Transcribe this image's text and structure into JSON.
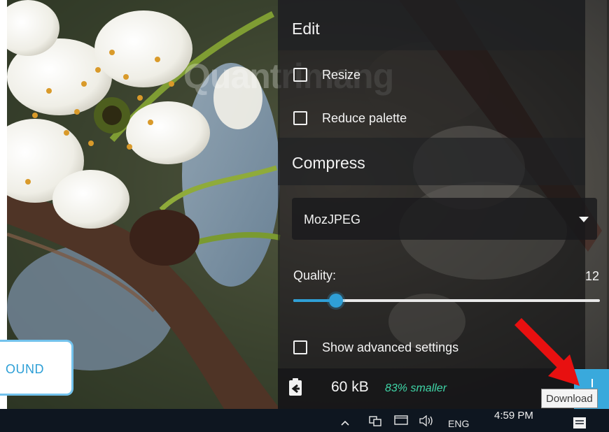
{
  "panel": {
    "edit_title": "Edit",
    "resize_label": "Resize",
    "reduce_palette_label": "Reduce palette",
    "compress_title": "Compress",
    "codec_selected": "MozJPEG",
    "quality_label": "Quality:",
    "quality_value": "12",
    "quality_fraction": 0.14,
    "advanced_label": "Show advanced settings",
    "resize_checked": false,
    "reduce_palette_checked": false,
    "advanced_checked": false
  },
  "result": {
    "size": "60 kB",
    "savings": "83% smaller"
  },
  "download": {
    "tooltip": "Download"
  },
  "left_button": {
    "label": "OUND"
  },
  "watermark": {
    "text": "Quantrimang"
  },
  "taskbar": {
    "time": "4:59 PM",
    "language": "ENG"
  },
  "colors": {
    "accent": "#2f9fd6",
    "savings": "#3fd6a8",
    "annotation_arrow": "#e81010"
  },
  "icons": [
    "copy-to-clipboard-icon",
    "download-icon",
    "chevron-up-icon",
    "network-icon",
    "display-icon",
    "volume-icon",
    "notification-icon"
  ]
}
